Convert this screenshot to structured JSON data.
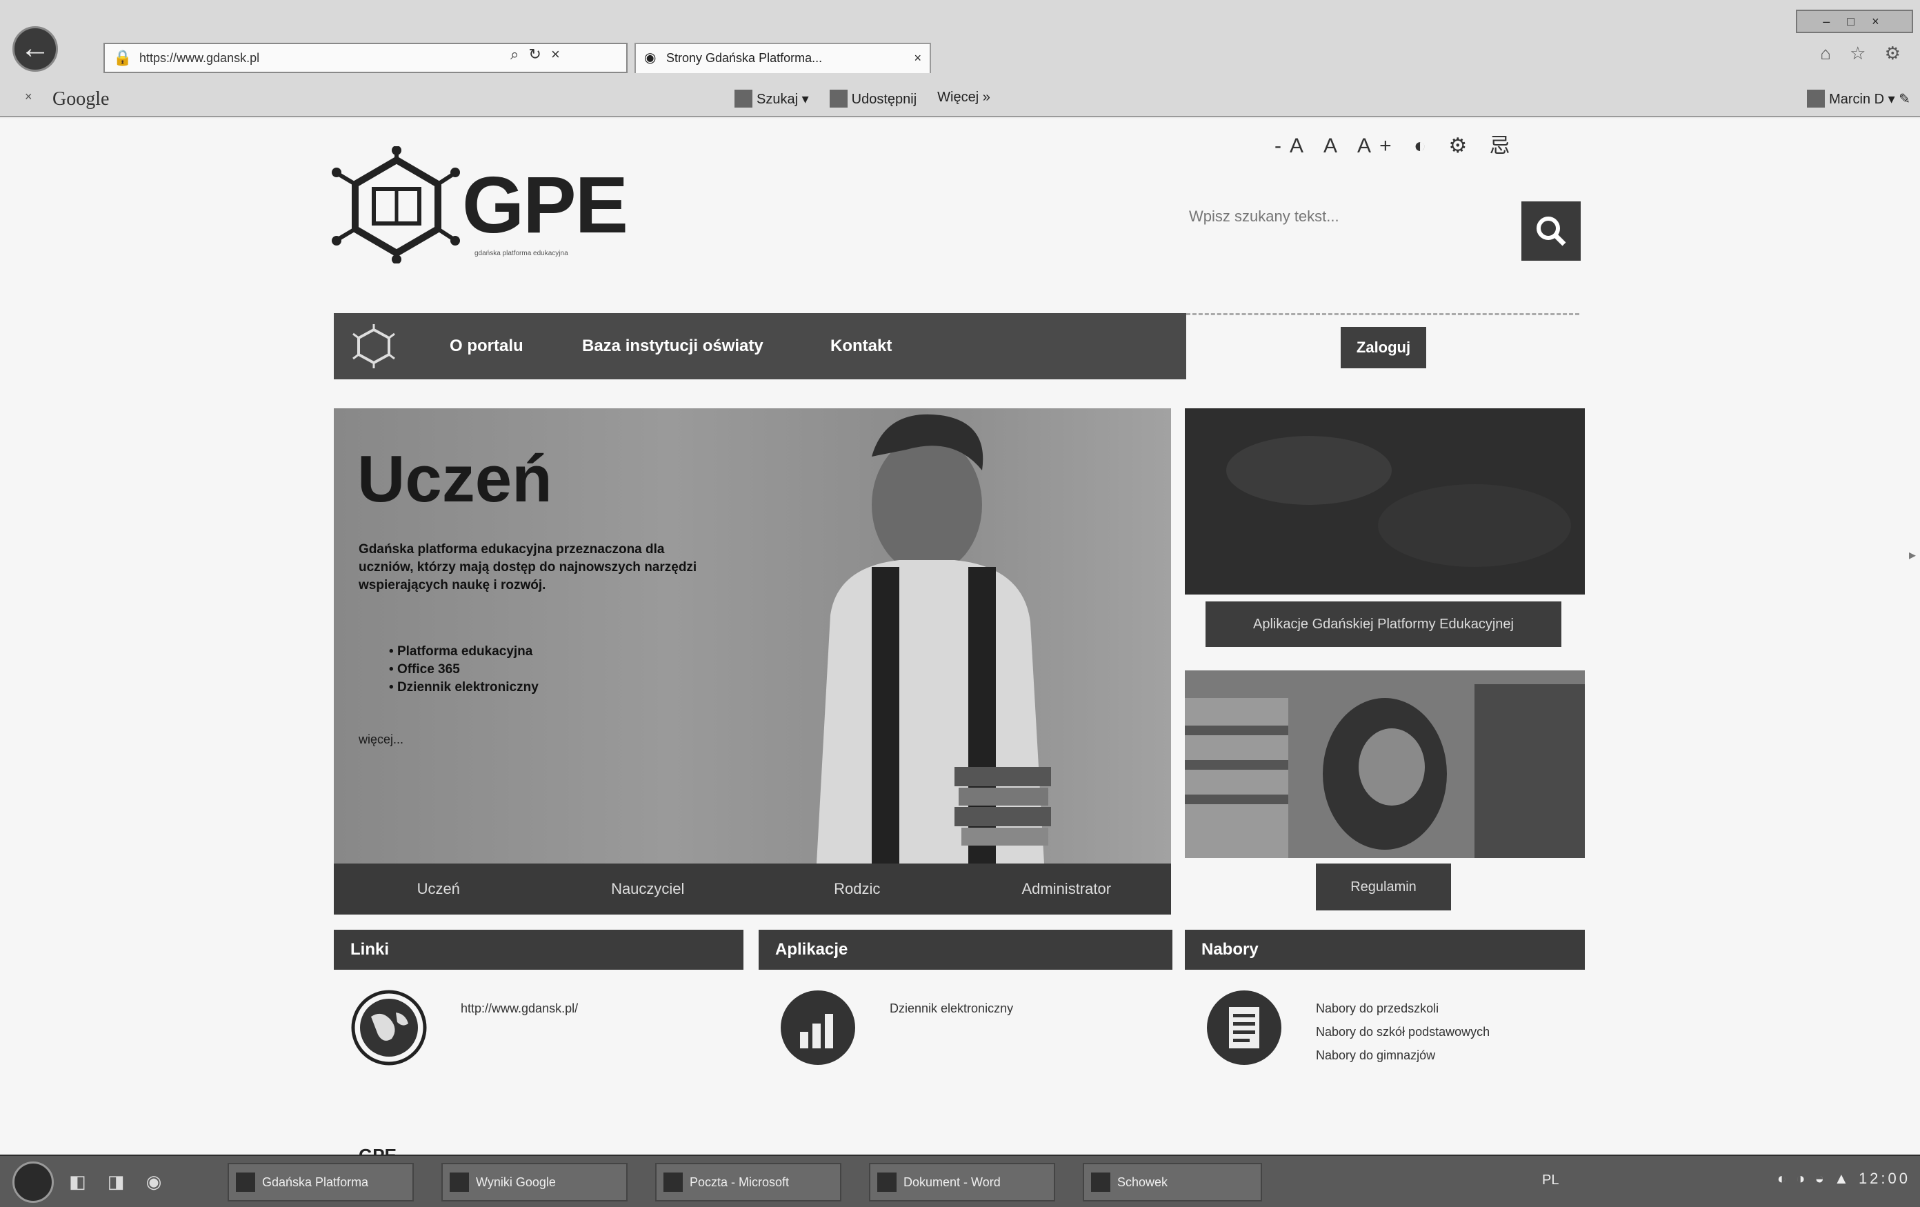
{
  "browser": {
    "address": "https://www.gdansk.pl",
    "tab_title": "Strony  Gdańska Platforma...",
    "tab_close": "×",
    "google_label": "Google",
    "toolbar": {
      "share": "Szukaj",
      "share_arrow": "▾",
      "shared_label": "Udostępnij",
      "more": "Więcej »",
      "account": "Marcin D"
    },
    "window_controls": "– □ ×",
    "icons": "⌂ ☆ ⚙"
  },
  "accessibility": {
    "text_size": "-A A A+",
    "contrast": "◐",
    "other": "⚙ 忌"
  },
  "logo": {
    "text": "GPE",
    "subtitle": "gdańska platforma edukacyjna"
  },
  "search": {
    "placeholder": "Wpisz szukany tekst..."
  },
  "nav": {
    "items": [
      "O portalu",
      "Baza instytucji oświaty",
      "Kontakt"
    ],
    "login": "Zaloguj"
  },
  "hero": {
    "title": "Uczeń",
    "description": "Gdańska platforma edukacyjna przeznaczona dla uczniów, którzy mają dostęp do najnowszych narzędzi wspierających naukę i rozwój.",
    "list": [
      "Platforma edukacyjna",
      "Office 365",
      "Dziennik elektroniczny"
    ],
    "more": "więcej...",
    "tabs": [
      "Uczeń",
      "Nauczyciel",
      "Rodzic",
      "Administrator"
    ]
  },
  "side": {
    "button1": "Aplikacje Gdańskiej Platformy Edukacyjnej",
    "button2": "Regulamin"
  },
  "sections": {
    "links": {
      "title": "Linki",
      "item": "http://www.gdansk.pl/"
    },
    "apps": {
      "title": "Aplikacje",
      "item": "Dziennik elektroniczny"
    },
    "recruit": {
      "title": "Nabory",
      "items": [
        "Nabory do przedszkoli",
        "Nabory do szkół podstawowych",
        "Nabory do gimnazjów"
      ]
    }
  },
  "taskbar": {
    "tasks": [
      "Gdańska Platforma",
      "Wyniki Google",
      "Poczta - Microsoft",
      "Dokument - Word",
      "Schowek"
    ],
    "lang": "PL",
    "time": "12:00"
  },
  "behind_text": "GPE"
}
